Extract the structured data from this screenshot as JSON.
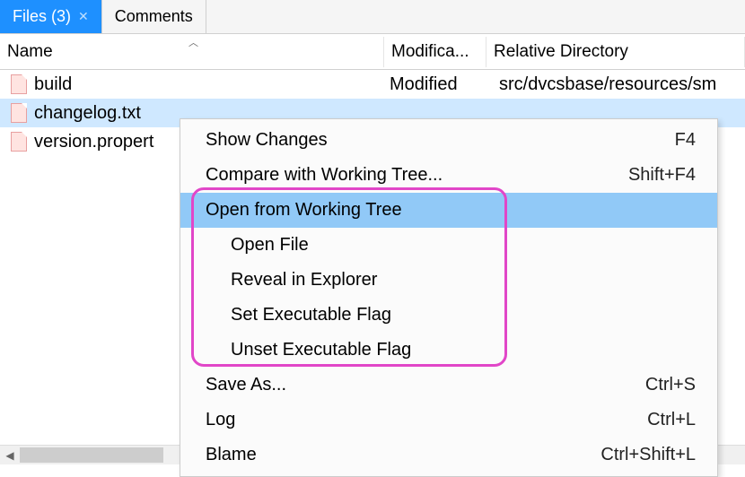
{
  "tabs": {
    "files": {
      "label": "Files (3)"
    },
    "comments": {
      "label": "Comments"
    }
  },
  "columns": {
    "name": "Name",
    "modification": "Modifica...",
    "relative": "Relative Directory"
  },
  "rows": [
    {
      "name": "build",
      "mod": "Modified",
      "rel": "src/dvcsbase/resources/sm"
    },
    {
      "name": "changelog.txt",
      "mod": "",
      "rel": ""
    },
    {
      "name": "version.propert",
      "mod": "",
      "rel": ""
    }
  ],
  "menu": {
    "show_changes": {
      "label": "Show Changes",
      "shortcut": "F4"
    },
    "compare_wt": {
      "label": "Compare with Working Tree...",
      "shortcut": "Shift+F4"
    },
    "open_wt": {
      "label": "Open from Working Tree",
      "shortcut": ""
    },
    "open_file": {
      "label": "Open File",
      "shortcut": ""
    },
    "reveal": {
      "label": "Reveal in Explorer",
      "shortcut": ""
    },
    "set_exec": {
      "label": "Set Executable Flag",
      "shortcut": ""
    },
    "unset_exec": {
      "label": "Unset Executable Flag",
      "shortcut": ""
    },
    "save_as": {
      "label": "Save As...",
      "shortcut": "Ctrl+S"
    },
    "log": {
      "label": "Log",
      "shortcut": "Ctrl+L"
    },
    "blame": {
      "label": "Blame",
      "shortcut": "Ctrl+Shift+L"
    }
  }
}
